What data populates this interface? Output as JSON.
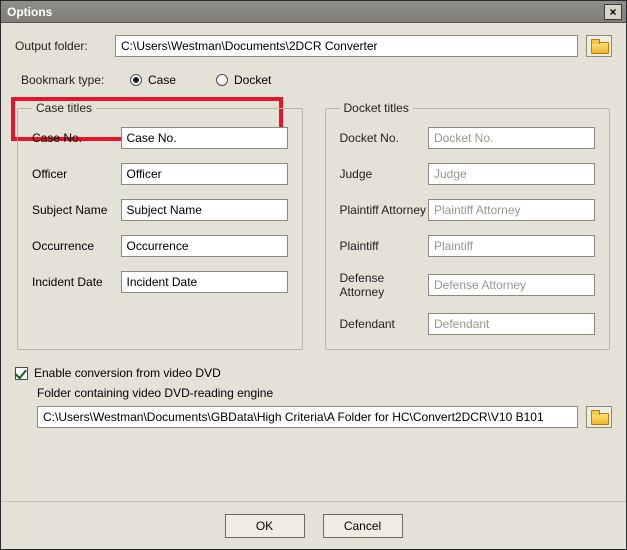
{
  "window": {
    "title": "Options",
    "close_glyph": "×"
  },
  "output": {
    "label": "Output folder:",
    "value": "C:\\Users\\Westman\\Documents\\2DCR Converter"
  },
  "bookmark": {
    "label": "Bookmark type:",
    "options": {
      "case": "Case",
      "docket": "Docket"
    },
    "selected": "case"
  },
  "case_group": {
    "legend": "Case titles",
    "fields": {
      "case_no": {
        "label": "Case No.",
        "value": "Case No."
      },
      "officer": {
        "label": "Officer",
        "value": "Officer"
      },
      "subject": {
        "label": "Subject Name",
        "value": "Subject Name"
      },
      "occurrence": {
        "label": "Occurrence",
        "value": "Occurrence"
      },
      "incident": {
        "label": "Incident Date",
        "value": "Incident Date"
      }
    }
  },
  "docket_group": {
    "legend": "Docket titles",
    "fields": {
      "docket_no": {
        "label": "Docket No.",
        "placeholder": "Docket No."
      },
      "judge": {
        "label": "Judge",
        "placeholder": "Judge"
      },
      "p_attorney": {
        "label": "Plaintiff Attorney",
        "placeholder": "Plaintiff Attorney"
      },
      "plaintiff": {
        "label": "Plaintiff",
        "placeholder": "Plaintiff"
      },
      "d_attorney": {
        "label": "Defense Attorney",
        "placeholder": "Defense Attorney"
      },
      "defendant": {
        "label": "Defendant",
        "placeholder": "Defendant"
      }
    }
  },
  "dvd": {
    "enable_label": "Enable conversion from video DVD",
    "enabled": true,
    "folder_label": "Folder containing video DVD-reading engine",
    "folder_value": "C:\\Users\\Westman\\Documents\\GBData\\High Criteria\\A Folder for HC\\Convert2DCR\\V10 B101"
  },
  "buttons": {
    "ok": "OK",
    "cancel": "Cancel"
  }
}
